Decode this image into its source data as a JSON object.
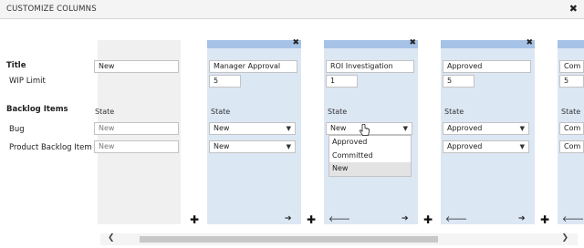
{
  "dialog": {
    "title": "CUSTOMIZE COLUMNS",
    "close_icon": "close-icon"
  },
  "row_labels": {
    "title": "Title",
    "wip_limit": "WIP Limit",
    "backlog_items": "Backlog Items",
    "bug": "Bug",
    "product_backlog_item": "Product Backlog Item"
  },
  "columns": [
    {
      "title": "New",
      "state_label": "State",
      "bug": "New",
      "pbi": "New"
    },
    {
      "title": "Manager Approval",
      "wip": "5",
      "state_label": "State",
      "bug": "New",
      "pbi": "New"
    },
    {
      "title": "ROI Investigation",
      "wip": "1",
      "state_label": "State",
      "bug": "New",
      "pbi": "New"
    },
    {
      "title": "Approved",
      "wip": "5",
      "state_label": "State",
      "bug": "Approved",
      "pbi": "Approved"
    },
    {
      "title": "Com",
      "wip": "5",
      "state_label": "State",
      "bug": "Com",
      "pbi": "Com"
    }
  ],
  "dropdown": {
    "options": [
      "Approved",
      "Committed",
      "New"
    ],
    "highlighted": "New"
  },
  "icons": {
    "add": "plus-icon",
    "left": "arrow-left-icon",
    "right": "arrow-right-icon"
  }
}
